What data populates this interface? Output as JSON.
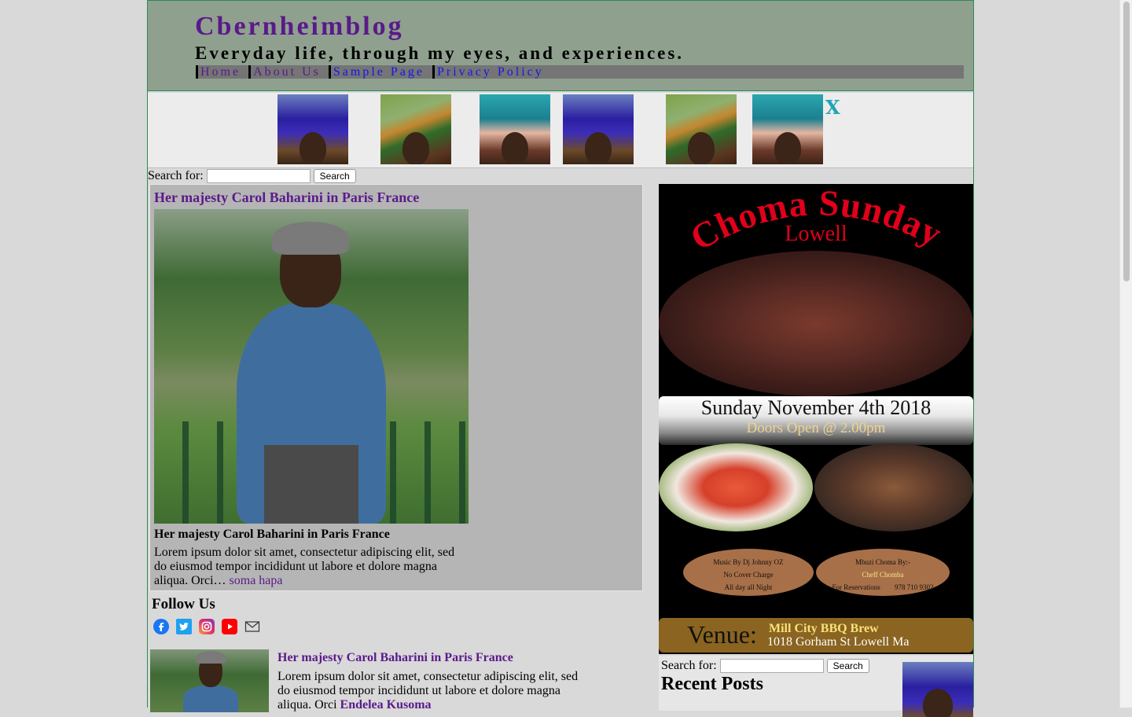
{
  "site": {
    "title": "Cbernheimblog",
    "tagline": "Everyday life, through my eyes, and experiences."
  },
  "nav": {
    "items": [
      "Home",
      "About Us",
      "Sample Page",
      "Privacy Policy"
    ]
  },
  "banner": {
    "close_label": "X",
    "thumbnails": [
      "headwrap-blue",
      "headwrap-kente",
      "headwrap-teal",
      "headwrap-blue",
      "headwrap-kente",
      "headwrap-teal"
    ]
  },
  "search": {
    "label": "Search for:",
    "button": "Search"
  },
  "post": {
    "title": "Her majesty Carol Baharini in Paris France",
    "caption": "Her majesty Carol Baharini in Paris France",
    "excerpt": "Lorem ipsum dolor sit amet, consectetur adipiscing elit, sed do eiusmod tempor incididunt ut labore et dolore magna aliqua. Orci…",
    "more_link": "soma hapa"
  },
  "follow": {
    "title": "Follow Us",
    "icons": [
      "facebook-icon",
      "twitter-icon",
      "instagram-icon",
      "youtube-icon",
      "email-icon"
    ]
  },
  "recent_item": {
    "title": "Her majesty Carol Baharini in Paris France",
    "excerpt": "Lorem ipsum dolor sit amet, consectetur adipiscing elit, sed do eiusmod tempor incididunt ut labore et dolore magna aliqua. Orci",
    "more_link": "Endelea Kusoma"
  },
  "poster": {
    "title": "Choma Sunday",
    "subtitle": "Lowell",
    "date": "Sunday  November 4th  2018",
    "doors": "Doors Open @ 2.00pm",
    "left_oval": [
      "Music By Dj Johnny OZ",
      "No Cover Charge",
      "All day all Night"
    ],
    "right_oval": [
      "Mbuzi Choma By:-",
      "Cheff Chomba",
      "For Reservations",
      "978 710 9302"
    ],
    "venue_label": "Venue:",
    "venue_name": "Mill City BBQ Brew",
    "venue_address": "1018 Gorham St Lowell Ma"
  },
  "sidebar": {
    "search_label": "Search for:",
    "search_button": "Search",
    "recent_heading": "Recent Posts"
  },
  "colors": {
    "header_bg": "#8fa08f",
    "title": "#5a1a8a",
    "link_blue": "#1515ee",
    "post_bg": "#b5b5b5",
    "page_bg": "#d9d9d9"
  }
}
